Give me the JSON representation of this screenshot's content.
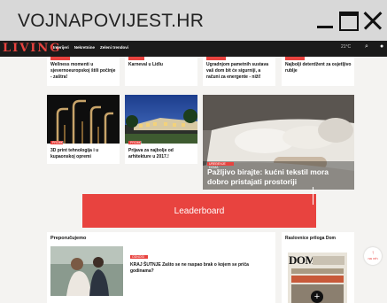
{
  "window": {
    "title": "VOJNAPOVIJEST.HR"
  },
  "nav": {
    "logo": "LIVING",
    "links": [
      "Interijeri",
      "Nekretnine",
      "Zeleni trendovi"
    ],
    "weather": "21°C",
    "icons": [
      "search-icon",
      "user-icon"
    ]
  },
  "top_row": [
    {
      "text": "Wellness momenti u sjevernoeuropskoj štili počinje - zaštra!"
    },
    {
      "text": "Karneval u Lidlu"
    },
    {
      "text": "Ugradnjom pametnih sustava vaš dom bit će sigurniji, a računi za energente - niži!"
    },
    {
      "text": "Najbolji deterdžent za osjetljivo rublje"
    }
  ],
  "mid_row": [
    {
      "tag": "PROMO",
      "text": "3D print tehnologija i u kupaonskoj opremi"
    },
    {
      "tag": "PROMO",
      "text": "Prijava za najbolje od arhitekture u 2017.!"
    },
    {
      "tag": "UREĐENJE DOMA",
      "text": "Pažljivo birajte: kućni tekstil mora dobro pristajati prostoriji"
    }
  ],
  "leaderboard": "Leaderboard",
  "recommended": {
    "heading": "Preporučujemo",
    "tag": "ODNOSI",
    "text": "KRAJ ŠUTNJE Zašto se ne raspao brak o kojem se priča godinama?"
  },
  "sidebar": {
    "heading": "Raslovnice priloga Dom",
    "cover_title": "DOM"
  },
  "back_to_top": "na vrh"
}
